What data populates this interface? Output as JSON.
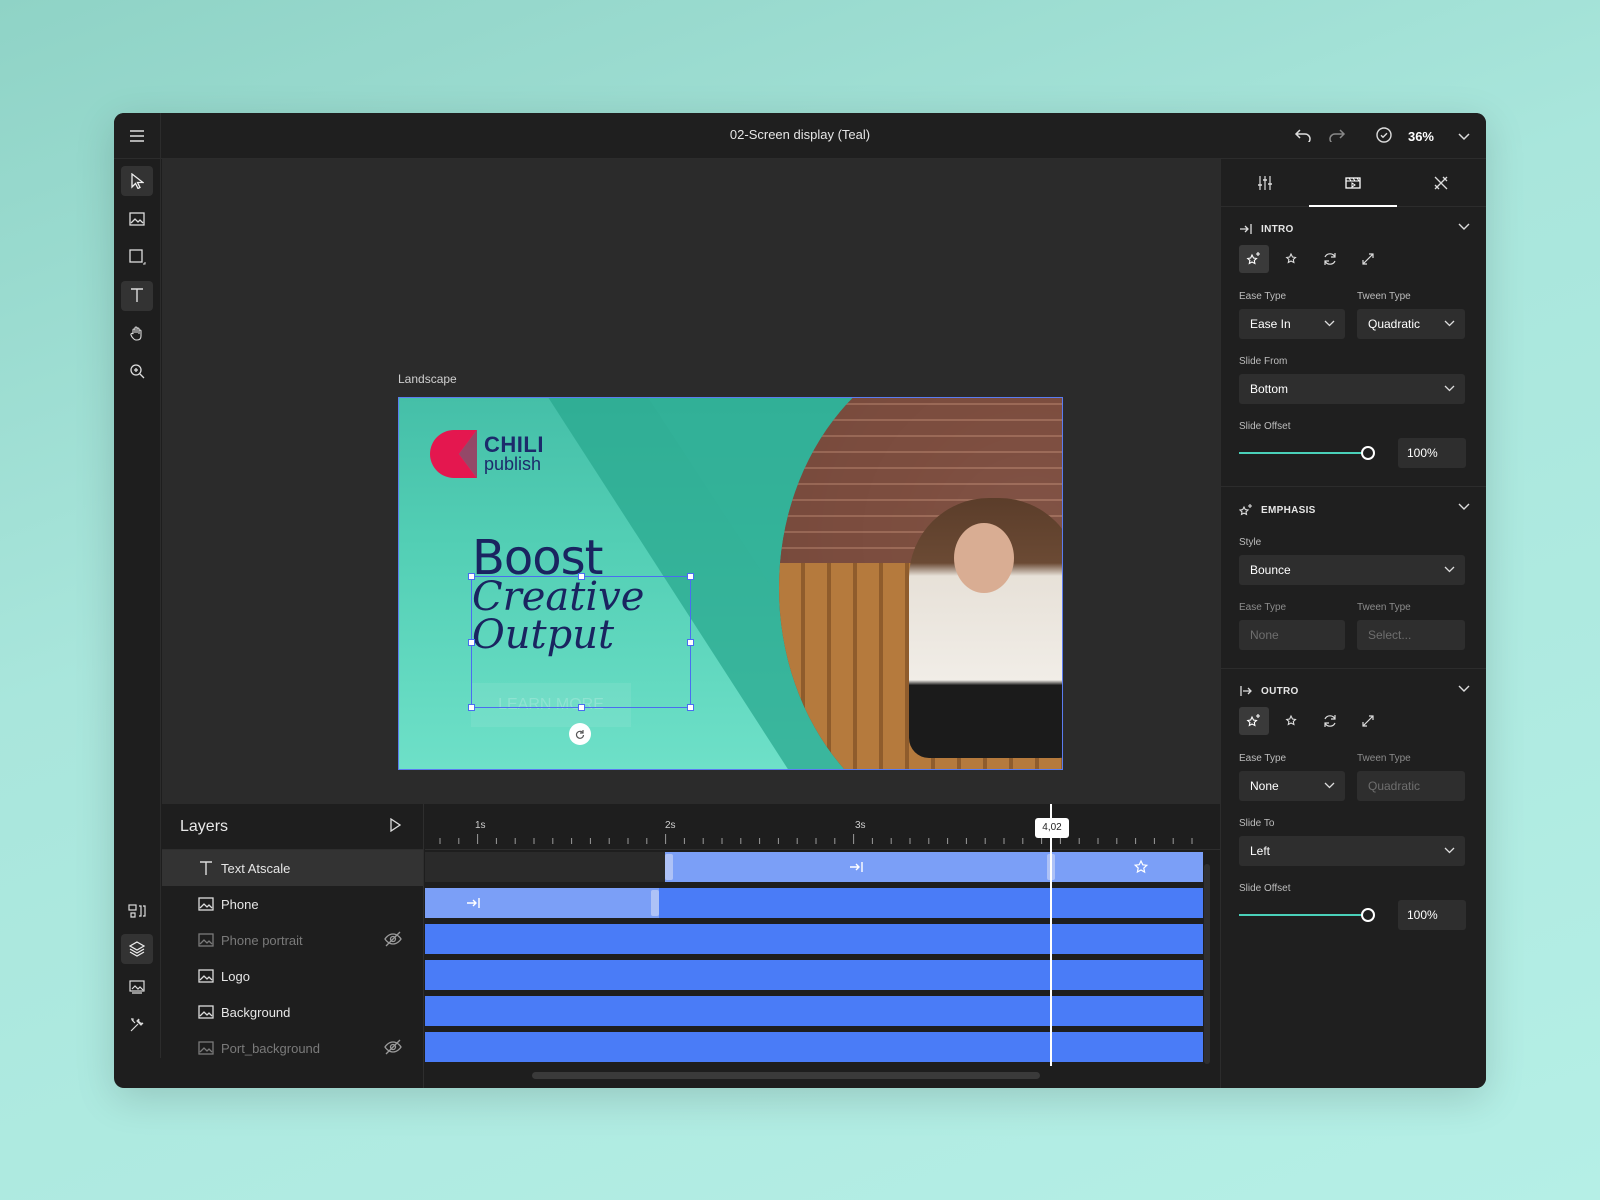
{
  "topbar": {
    "document_title": "02-Screen display (Teal)",
    "zoom": "36%"
  },
  "canvas": {
    "frame_label": "Landscape",
    "artboard": {
      "logo_line1": "CHILI",
      "logo_line2": "publish",
      "headline_line1": "Boost",
      "headline_line2": "Creative Output",
      "ghost_button": "LEARN MORE"
    }
  },
  "layers": {
    "title": "Layers",
    "items": [
      {
        "name": "Text Atscale",
        "icon": "text-icon",
        "active": true,
        "hidden": false
      },
      {
        "name": "Phone",
        "icon": "image-icon",
        "active": false,
        "hidden": false
      },
      {
        "name": "Phone portrait",
        "icon": "image-icon",
        "active": false,
        "hidden": true
      },
      {
        "name": "Logo",
        "icon": "image-icon",
        "active": false,
        "hidden": false
      },
      {
        "name": "Background",
        "icon": "image-icon",
        "active": false,
        "hidden": false
      },
      {
        "name": "Port_background",
        "icon": "image-icon",
        "active": false,
        "hidden": true
      }
    ]
  },
  "timeline": {
    "ticks": [
      "1s",
      "2s",
      "3s"
    ],
    "playhead": "4,02"
  },
  "panel": {
    "intro": {
      "title": "INTRO",
      "ease_type_label": "Ease Type",
      "ease_type": "Ease In",
      "tween_type_label": "Tween Type",
      "tween_type": "Quadratic",
      "slide_from_label": "Slide From",
      "slide_from": "Bottom",
      "slide_offset_label": "Slide Offset",
      "slide_offset": "100%"
    },
    "emphasis": {
      "title": "EMPHASIS",
      "style_label": "Style",
      "style": "Bounce",
      "ease_type_label": "Ease Type",
      "ease_type": "None",
      "tween_type_label": "Tween Type",
      "tween_type": "Select..."
    },
    "outro": {
      "title": "OUTRO",
      "ease_type_label": "Ease Type",
      "ease_type": "None",
      "tween_type_label": "Tween Type",
      "tween_type": "Quadratic",
      "slide_to_label": "Slide To",
      "slide_to": "Left",
      "slide_offset_label": "Slide Offset",
      "slide_offset": "100%"
    }
  }
}
